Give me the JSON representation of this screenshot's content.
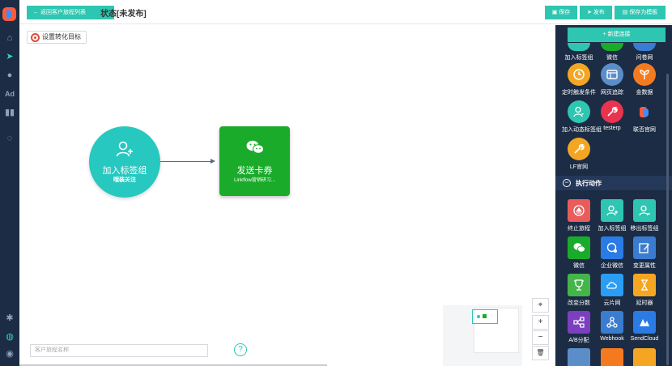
{
  "app": {
    "accent": "#2ec6b1",
    "nav_bg": "#1c2c44"
  },
  "topbar": {
    "back_label": "← 返回客户旅程列表",
    "title": "状态[未发布]",
    "save_label": "保存",
    "publish_label": "发布",
    "save_template_label": "保存为模板"
  },
  "canvas": {
    "goal_label": "设置转化目标",
    "node1": {
      "title": "加入标签组",
      "subtitle": "哦装关注",
      "color": "#27c8c0"
    },
    "node2": {
      "title": "发送卡券",
      "subtitle": "Linkflow营销研习...",
      "color": "#1aab2a"
    },
    "search_placeholder": "客户旅程名称",
    "help_label": "?",
    "zoom": {
      "fit": "⌖",
      "in": "+",
      "out": "−",
      "delete": "🗑"
    }
  },
  "panel": {
    "new_conn_label": "+ 新建连接",
    "partial_row": [
      {
        "label": "加入标签组",
        "color": "#2ec6b1"
      },
      {
        "label": "微信",
        "color": "#1aab2a"
      },
      {
        "label": "问卷网",
        "color": "#3a7ccf"
      }
    ],
    "triggers": [
      {
        "label": "定时触发条件",
        "color": "#f4a623",
        "icon": "clock-icon"
      },
      {
        "label": "网页追踪",
        "color": "#5b8ec8",
        "icon": "browser-icon"
      },
      {
        "label": "金数据",
        "color": "#f47a20",
        "icon": "leaf-icon"
      },
      {
        "label": "加入动态标签组",
        "color": "#2ec6b1",
        "icon": "user-filter-icon"
      },
      {
        "label": "testerp",
        "color": "#e8344e",
        "icon": "wrench-icon"
      },
      {
        "label": "联否官网",
        "color": "#1c2c44",
        "icon": "brand-logo-icon"
      },
      {
        "label": "LF官网",
        "color": "#f4a623",
        "icon": "wrench-icon"
      }
    ],
    "section_title": "执行动作",
    "section_toggle": "−",
    "actions": [
      {
        "label": "终止旅程",
        "color": "#e85c5c",
        "icon": "eject-icon"
      },
      {
        "label": "加入标签组",
        "color": "#2ec6b1",
        "icon": "user-add-icon"
      },
      {
        "label": "移出标签组",
        "color": "#2ec6b1",
        "icon": "user-remove-icon"
      },
      {
        "label": "微信",
        "color": "#1aab2a",
        "icon": "wechat-icon"
      },
      {
        "label": "企业微信",
        "color": "#2a7be4",
        "icon": "chat-icon"
      },
      {
        "label": "变更属性",
        "color": "#3a7ccf",
        "icon": "edit-icon"
      },
      {
        "label": "改变分数",
        "color": "#44b549",
        "icon": "trophy-icon"
      },
      {
        "label": "云片网",
        "color": "#2a9df4",
        "icon": "cloud-icon"
      },
      {
        "label": "延时器",
        "color": "#f4a623",
        "icon": "hourglass-icon"
      },
      {
        "label": "A/B分配",
        "color": "#7b3fbf",
        "icon": "split-icon"
      },
      {
        "label": "Webhook",
        "color": "#3a7ccf",
        "icon": "webhook-icon"
      },
      {
        "label": "SendCloud",
        "color": "#2a7be4",
        "icon": "sendcloud-icon"
      },
      {
        "label": "",
        "color": "#5b8ec8",
        "icon": "cloud-icon"
      },
      {
        "label": "",
        "color": "#f47a20",
        "icon": "stack-icon"
      },
      {
        "label": "",
        "color": "#f4a623",
        "icon": "bell-icon"
      }
    ]
  }
}
